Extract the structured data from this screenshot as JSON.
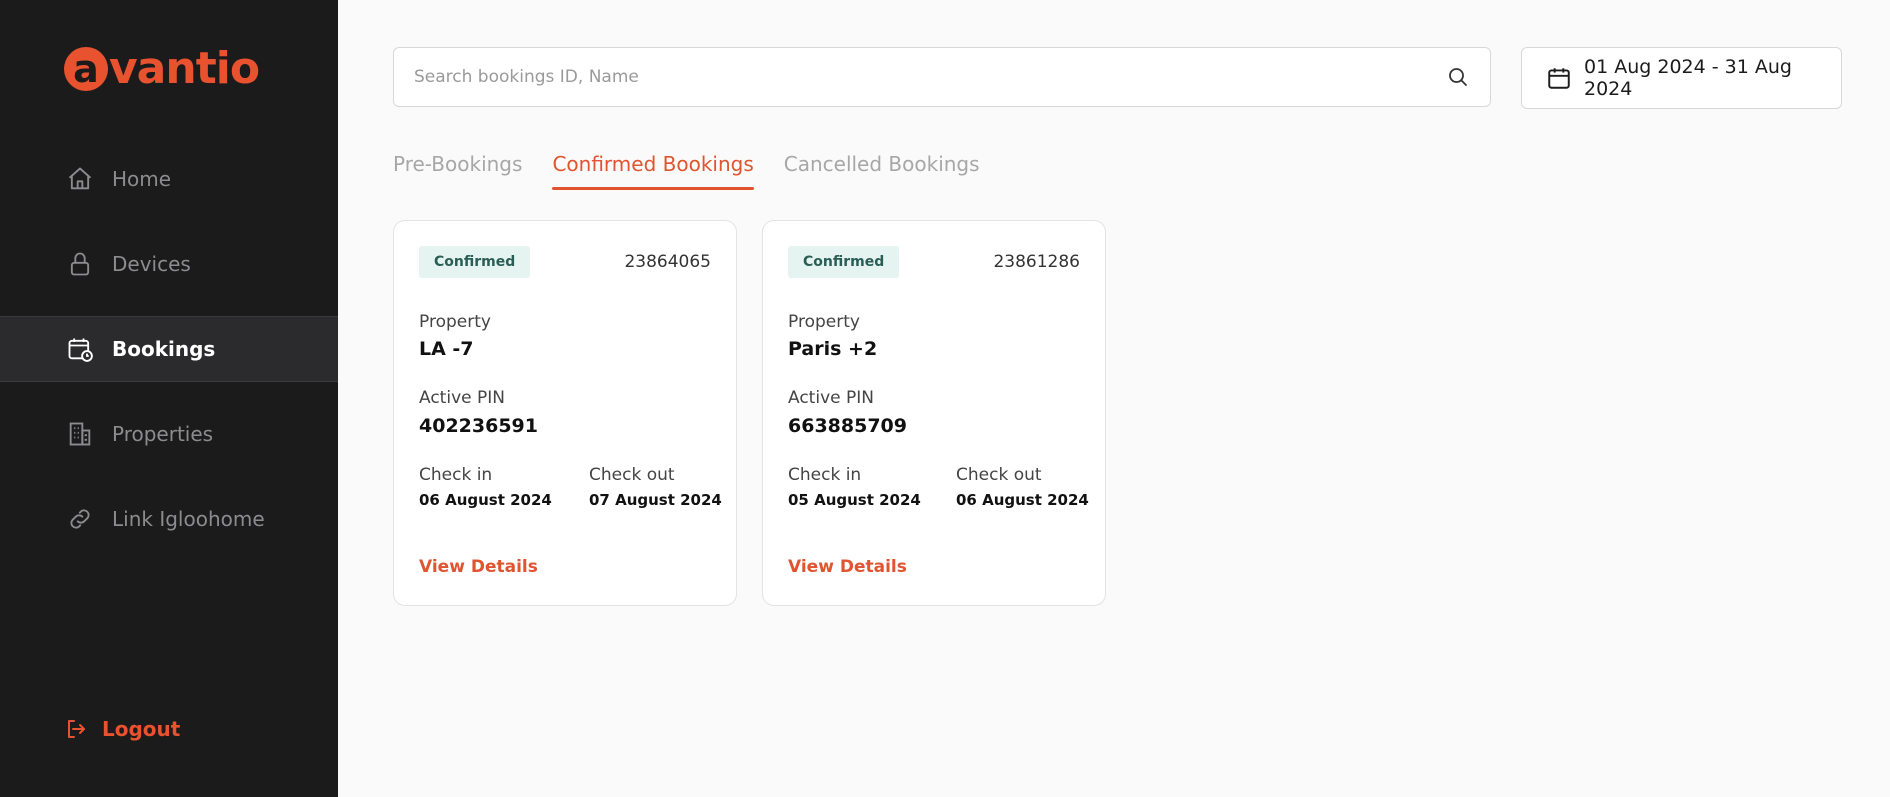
{
  "brand": {
    "logo_letter": "a",
    "logo_rest": "vantio",
    "color": "#e8522f"
  },
  "sidebar": {
    "items": [
      {
        "label": "Home",
        "icon": "home-icon",
        "active": false
      },
      {
        "label": "Devices",
        "icon": "lock-icon",
        "active": false
      },
      {
        "label": "Bookings",
        "icon": "calendar-clock-icon",
        "active": true
      },
      {
        "label": "Properties",
        "icon": "building-icon",
        "active": false
      },
      {
        "label": "Link Igloohome",
        "icon": "link-icon",
        "active": false
      }
    ],
    "logout_label": "Logout"
  },
  "search": {
    "placeholder": "Search bookings ID, Name",
    "value": ""
  },
  "date_range": {
    "label": "01 Aug 2024 - 31 Aug 2024"
  },
  "tabs": [
    {
      "label": "Pre-Bookings",
      "active": false
    },
    {
      "label": "Confirmed Bookings",
      "active": true
    },
    {
      "label": "Cancelled Bookings",
      "active": false
    }
  ],
  "labels": {
    "property": "Property",
    "active_pin": "Active PIN",
    "check_in": "Check in",
    "check_out": "Check out",
    "view_details": "View Details"
  },
  "bookings": [
    {
      "status": "Confirmed",
      "id": "23864065",
      "property": "LA -7",
      "pin": "402236591",
      "check_in": "06 August 2024",
      "check_out": "07 August 2024"
    },
    {
      "status": "Confirmed",
      "id": "23861286",
      "property": "Paris +2",
      "pin": "663885709",
      "check_in": "05 August 2024",
      "check_out": "06 August 2024"
    }
  ],
  "colors": {
    "accent": "#e0542f",
    "sidebar_bg": "#1b1b1c",
    "badge_bg": "#e5f3f1",
    "badge_text": "#2a5e55"
  }
}
